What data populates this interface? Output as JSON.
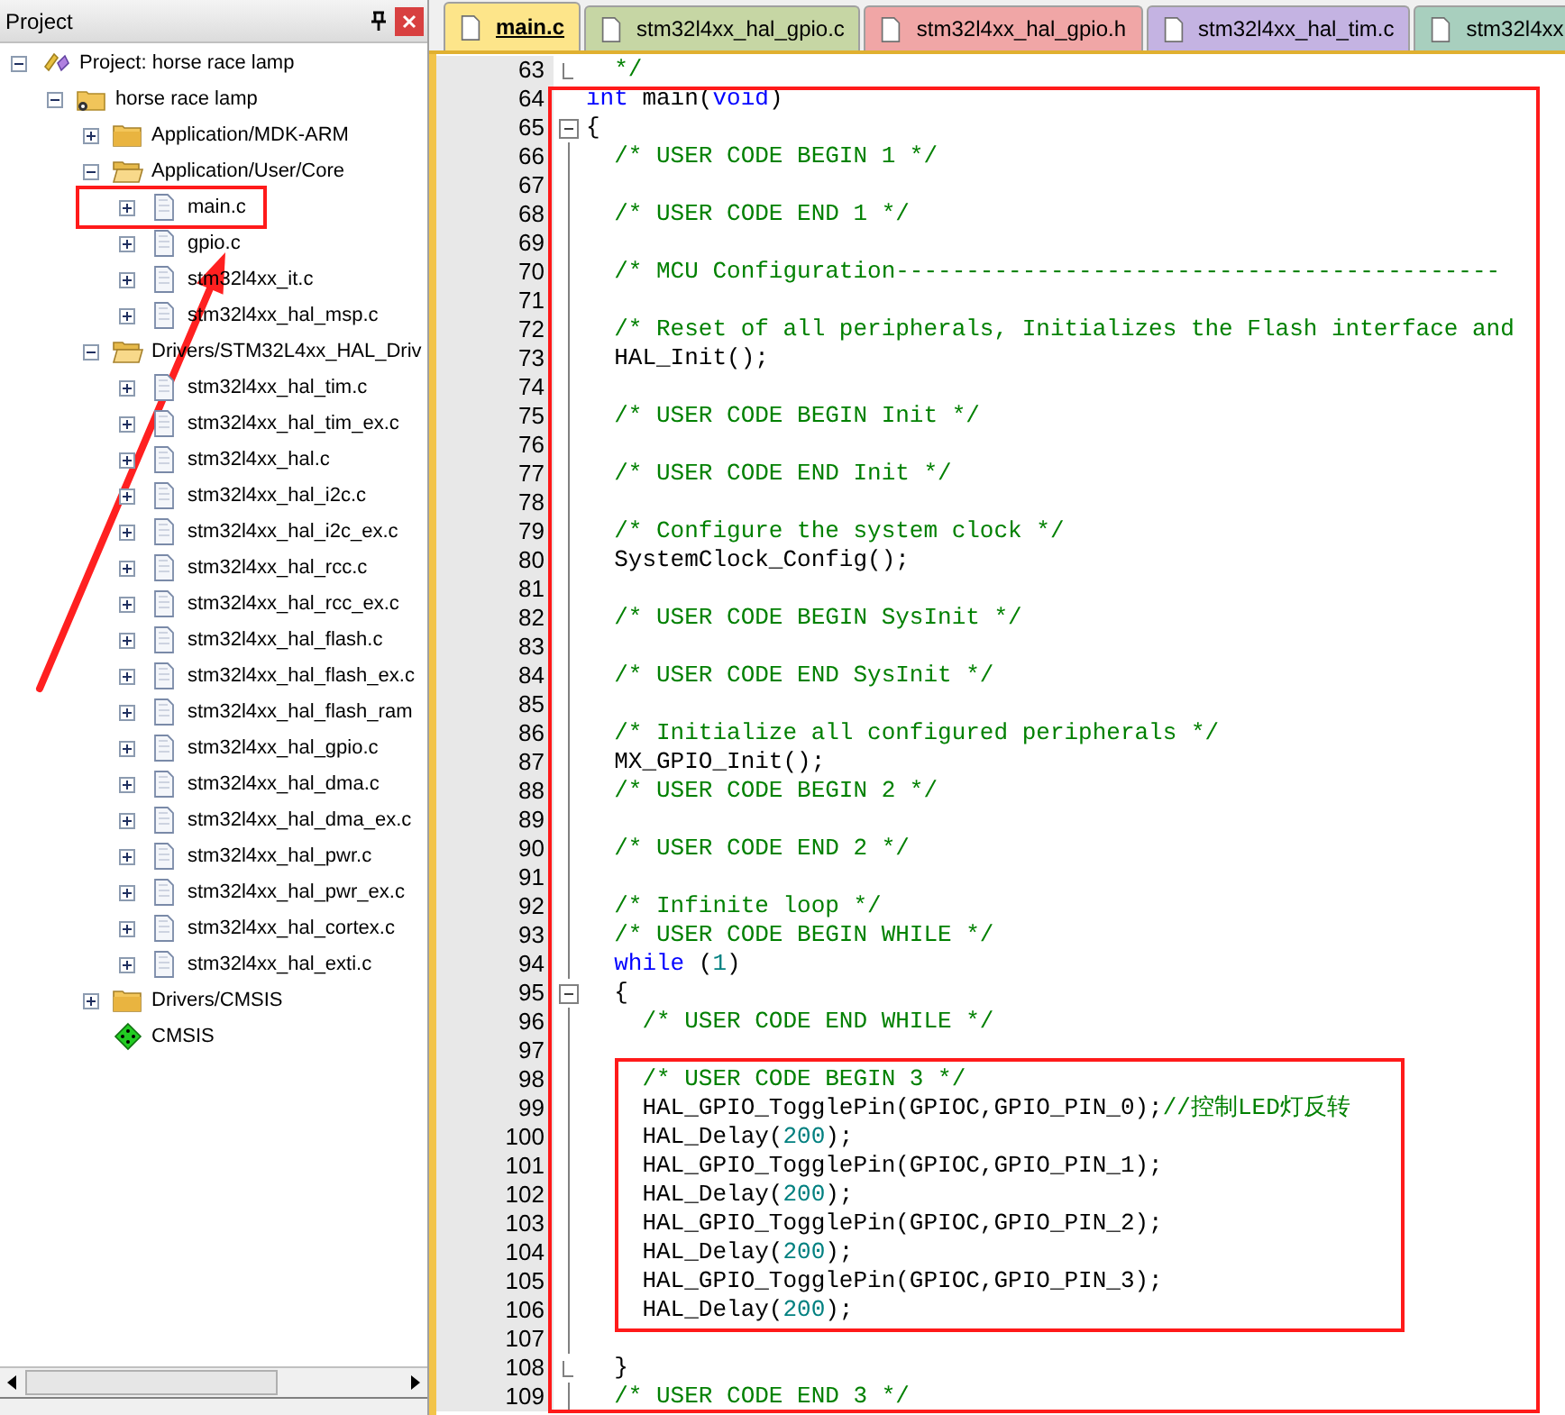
{
  "project_panel": {
    "title": "Project",
    "tree": [
      {
        "label": "Project: horse race lamp",
        "kind": "project",
        "expanded": true,
        "highlighted": false,
        "children": [
          {
            "label": "horse race lamp",
            "kind": "target",
            "expanded": true,
            "highlighted": false,
            "children": [
              {
                "label": "Application/MDK-ARM",
                "kind": "folder",
                "expanded": false,
                "highlighted": false
              },
              {
                "label": "Application/User/Core",
                "kind": "folder",
                "expanded": true,
                "highlighted": false,
                "children": [
                  {
                    "label": "main.c",
                    "kind": "file",
                    "expanded": false,
                    "highlighted": true
                  },
                  {
                    "label": "gpio.c",
                    "kind": "file",
                    "expanded": false,
                    "highlighted": false
                  },
                  {
                    "label": "stm32l4xx_it.c",
                    "kind": "file",
                    "expanded": false,
                    "highlighted": false
                  },
                  {
                    "label": "stm32l4xx_hal_msp.c",
                    "kind": "file",
                    "expanded": false,
                    "highlighted": false
                  }
                ]
              },
              {
                "label": "Drivers/STM32L4xx_HAL_Driv",
                "kind": "folder",
                "expanded": true,
                "highlighted": false,
                "children": [
                  {
                    "label": "stm32l4xx_hal_tim.c",
                    "kind": "file",
                    "expanded": false,
                    "highlighted": false
                  },
                  {
                    "label": "stm32l4xx_hal_tim_ex.c",
                    "kind": "file",
                    "expanded": false,
                    "highlighted": false
                  },
                  {
                    "label": "stm32l4xx_hal.c",
                    "kind": "file",
                    "expanded": false,
                    "highlighted": false
                  },
                  {
                    "label": "stm32l4xx_hal_i2c.c",
                    "kind": "file",
                    "expanded": false,
                    "highlighted": false
                  },
                  {
                    "label": "stm32l4xx_hal_i2c_ex.c",
                    "kind": "file",
                    "expanded": false,
                    "highlighted": false
                  },
                  {
                    "label": "stm32l4xx_hal_rcc.c",
                    "kind": "file",
                    "expanded": false,
                    "highlighted": false
                  },
                  {
                    "label": "stm32l4xx_hal_rcc_ex.c",
                    "kind": "file",
                    "expanded": false,
                    "highlighted": false
                  },
                  {
                    "label": "stm32l4xx_hal_flash.c",
                    "kind": "file",
                    "expanded": false,
                    "highlighted": false
                  },
                  {
                    "label": "stm32l4xx_hal_flash_ex.c",
                    "kind": "file",
                    "expanded": false,
                    "highlighted": false
                  },
                  {
                    "label": "stm32l4xx_hal_flash_ram",
                    "kind": "file",
                    "expanded": false,
                    "highlighted": false
                  },
                  {
                    "label": "stm32l4xx_hal_gpio.c",
                    "kind": "file",
                    "expanded": false,
                    "highlighted": false
                  },
                  {
                    "label": "stm32l4xx_hal_dma.c",
                    "kind": "file",
                    "expanded": false,
                    "highlighted": false
                  },
                  {
                    "label": "stm32l4xx_hal_dma_ex.c",
                    "kind": "file",
                    "expanded": false,
                    "highlighted": false
                  },
                  {
                    "label": "stm32l4xx_hal_pwr.c",
                    "kind": "file",
                    "expanded": false,
                    "highlighted": false
                  },
                  {
                    "label": "stm32l4xx_hal_pwr_ex.c",
                    "kind": "file",
                    "expanded": false,
                    "highlighted": false
                  },
                  {
                    "label": "stm32l4xx_hal_cortex.c",
                    "kind": "file",
                    "expanded": false,
                    "highlighted": false
                  },
                  {
                    "label": "stm32l4xx_hal_exti.c",
                    "kind": "file",
                    "expanded": false,
                    "highlighted": false
                  }
                ]
              },
              {
                "label": "Drivers/CMSIS",
                "kind": "folder",
                "expanded": false,
                "highlighted": false
              },
              {
                "label": "CMSIS",
                "kind": "component",
                "highlighted": false
              }
            ]
          }
        ]
      }
    ]
  },
  "editor": {
    "highlighted": true,
    "tabs": [
      {
        "label": "main.c",
        "selected": true,
        "color": "#fde58a"
      },
      {
        "label": "stm32l4xx_hal_gpio.c",
        "selected": false,
        "color": "#c6d6a4"
      },
      {
        "label": "stm32l4xx_hal_gpio.h",
        "selected": false,
        "color": "#f0a6a6"
      },
      {
        "label": "stm32l4xx_hal_tim.c",
        "selected": false,
        "color": "#c4b3e2"
      },
      {
        "label": "stm32l4xx",
        "selected": false,
        "color": "#a8cfbe"
      }
    ],
    "lines": [
      {
        "number": "63",
        "kind": "fold_end",
        "boxed": false,
        "segments": [
          {
            "kind": "comment",
            "text": "  */"
          }
        ]
      },
      {
        "number": "64",
        "kind": "plain",
        "boxed": false,
        "segments": [
          {
            "kind": "keyword",
            "text": "int"
          },
          {
            "kind": "plain",
            "text": " main("
          },
          {
            "kind": "keyword",
            "text": "void"
          },
          {
            "kind": "plain",
            "text": ")"
          }
        ]
      },
      {
        "number": "65",
        "kind": "fold_start",
        "boxed": false,
        "segments": [
          {
            "kind": "plain",
            "text": "{"
          }
        ]
      },
      {
        "number": "66",
        "kind": "fold_body",
        "boxed": false,
        "segments": [
          {
            "kind": "comment",
            "text": "  /* USER CODE BEGIN 1 */"
          }
        ]
      },
      {
        "number": "67",
        "kind": "fold_body",
        "boxed": false
      },
      {
        "number": "68",
        "kind": "fold_body",
        "boxed": false,
        "segments": [
          {
            "kind": "comment",
            "text": "  /* USER CODE END 1 */"
          }
        ]
      },
      {
        "number": "69",
        "kind": "fold_body",
        "boxed": false
      },
      {
        "number": "70",
        "kind": "fold_body",
        "boxed": false,
        "segments": [
          {
            "kind": "comment",
            "text": "  /* MCU Configuration-------------------------------------------"
          }
        ]
      },
      {
        "number": "71",
        "kind": "fold_body",
        "boxed": false
      },
      {
        "number": "72",
        "kind": "fold_body",
        "boxed": false,
        "segments": [
          {
            "kind": "comment",
            "text": "  /* Reset of all peripherals, Initializes the Flash interface and"
          }
        ]
      },
      {
        "number": "73",
        "kind": "fold_body",
        "boxed": false,
        "segments": [
          {
            "kind": "plain",
            "text": "  HAL_Init();"
          }
        ]
      },
      {
        "number": "74",
        "kind": "fold_body",
        "boxed": false
      },
      {
        "number": "75",
        "kind": "fold_body",
        "boxed": false,
        "segments": [
          {
            "kind": "comment",
            "text": "  /* USER CODE BEGIN Init */"
          }
        ]
      },
      {
        "number": "76",
        "kind": "fold_body",
        "boxed": false
      },
      {
        "number": "77",
        "kind": "fold_body",
        "boxed": false,
        "segments": [
          {
            "kind": "comment",
            "text": "  /* USER CODE END Init */"
          }
        ]
      },
      {
        "number": "78",
        "kind": "fold_body",
        "boxed": false
      },
      {
        "number": "79",
        "kind": "fold_body",
        "boxed": false,
        "segments": [
          {
            "kind": "comment",
            "text": "  /* Configure the system clock */"
          }
        ]
      },
      {
        "number": "80",
        "kind": "fold_body",
        "boxed": false,
        "segments": [
          {
            "kind": "plain",
            "text": "  SystemClock_Config();"
          }
        ]
      },
      {
        "number": "81",
        "kind": "fold_body",
        "boxed": false
      },
      {
        "number": "82",
        "kind": "fold_body",
        "boxed": false,
        "segments": [
          {
            "kind": "comment",
            "text": "  /* USER CODE BEGIN SysInit */"
          }
        ]
      },
      {
        "number": "83",
        "kind": "fold_body",
        "boxed": false
      },
      {
        "number": "84",
        "kind": "fold_body",
        "boxed": false,
        "segments": [
          {
            "kind": "comment",
            "text": "  /* USER CODE END SysInit */"
          }
        ]
      },
      {
        "number": "85",
        "kind": "fold_body",
        "boxed": false
      },
      {
        "number": "86",
        "kind": "fold_body",
        "boxed": false,
        "segments": [
          {
            "kind": "comment",
            "text": "  /* Initialize all configured peripherals */"
          }
        ]
      },
      {
        "number": "87",
        "kind": "fold_body",
        "boxed": false,
        "segments": [
          {
            "kind": "plain",
            "text": "  MX_GPIO_Init();"
          }
        ]
      },
      {
        "number": "88",
        "kind": "fold_body",
        "boxed": false,
        "segments": [
          {
            "kind": "comment",
            "text": "  /* USER CODE BEGIN 2 */"
          }
        ]
      },
      {
        "number": "89",
        "kind": "fold_body",
        "boxed": false
      },
      {
        "number": "90",
        "kind": "fold_body",
        "boxed": false,
        "segments": [
          {
            "kind": "comment",
            "text": "  /* USER CODE END 2 */"
          }
        ]
      },
      {
        "number": "91",
        "kind": "fold_body",
        "boxed": false
      },
      {
        "number": "92",
        "kind": "fold_body",
        "boxed": false,
        "segments": [
          {
            "kind": "comment",
            "text": "  /* Infinite loop */"
          }
        ]
      },
      {
        "number": "93",
        "kind": "fold_body",
        "boxed": false,
        "segments": [
          {
            "kind": "comment",
            "text": "  /* USER CODE BEGIN WHILE */"
          }
        ]
      },
      {
        "number": "94",
        "kind": "fold_body",
        "boxed": false,
        "segments": [
          {
            "kind": "keyword",
            "text": "  while"
          },
          {
            "kind": "plain",
            "text": " ("
          },
          {
            "kind": "number",
            "text": "1"
          },
          {
            "kind": "plain",
            "text": ")"
          }
        ]
      },
      {
        "number": "95",
        "kind": "fold_start",
        "boxed": false,
        "segments": [
          {
            "kind": "plain",
            "text": "  {"
          }
        ]
      },
      {
        "number": "96",
        "kind": "fold_body",
        "boxed": false,
        "segments": [
          {
            "kind": "comment",
            "text": "    /* USER CODE END WHILE */"
          }
        ]
      },
      {
        "number": "97",
        "kind": "fold_body",
        "boxed": false
      },
      {
        "number": "98",
        "kind": "fold_body",
        "boxed": true,
        "segments": [
          {
            "kind": "comment",
            "text": "    /* USER CODE BEGIN 3 */"
          }
        ]
      },
      {
        "number": "99",
        "kind": "fold_body",
        "boxed": true,
        "segments": [
          {
            "kind": "plain",
            "text": "    HAL_GPIO_TogglePin(GPIOC,GPIO_PIN_0);"
          },
          {
            "kind": "comment",
            "text": "//控制LED灯反转"
          }
        ]
      },
      {
        "number": "100",
        "kind": "fold_body",
        "boxed": true,
        "segments": [
          {
            "kind": "plain",
            "text": "    HAL_Delay("
          },
          {
            "kind": "number",
            "text": "200"
          },
          {
            "kind": "plain",
            "text": ");"
          }
        ]
      },
      {
        "number": "101",
        "kind": "fold_body",
        "boxed": true,
        "segments": [
          {
            "kind": "plain",
            "text": "    HAL_GPIO_TogglePin(GPIOC,GPIO_PIN_1);"
          }
        ]
      },
      {
        "number": "102",
        "kind": "fold_body",
        "boxed": true,
        "segments": [
          {
            "kind": "plain",
            "text": "    HAL_Delay("
          },
          {
            "kind": "number",
            "text": "200"
          },
          {
            "kind": "plain",
            "text": ");"
          }
        ]
      },
      {
        "number": "103",
        "kind": "fold_body",
        "boxed": true,
        "segments": [
          {
            "kind": "plain",
            "text": "    HAL_GPIO_TogglePin(GPIOC,GPIO_PIN_2);"
          }
        ]
      },
      {
        "number": "104",
        "kind": "fold_body",
        "boxed": true,
        "segments": [
          {
            "kind": "plain",
            "text": "    HAL_Delay("
          },
          {
            "kind": "number",
            "text": "200"
          },
          {
            "kind": "plain",
            "text": ");"
          }
        ]
      },
      {
        "number": "105",
        "kind": "fold_body",
        "boxed": true,
        "segments": [
          {
            "kind": "plain",
            "text": "    HAL_GPIO_TogglePin(GPIOC,GPIO_PIN_3);"
          }
        ]
      },
      {
        "number": "106",
        "kind": "fold_body",
        "boxed": true,
        "segments": [
          {
            "kind": "plain",
            "text": "    HAL_Delay("
          },
          {
            "kind": "number",
            "text": "200"
          },
          {
            "kind": "plain",
            "text": ");"
          }
        ]
      },
      {
        "number": "107",
        "kind": "fold_body",
        "boxed": false
      },
      {
        "number": "108",
        "kind": "fold_end",
        "boxed": false,
        "segments": [
          {
            "kind": "plain",
            "text": "  }"
          }
        ]
      },
      {
        "number": "109",
        "kind": "fold_body",
        "boxed": false,
        "segments": [
          {
            "kind": "comment",
            "text": "  /* USER CODE END 3 */"
          }
        ]
      }
    ]
  }
}
